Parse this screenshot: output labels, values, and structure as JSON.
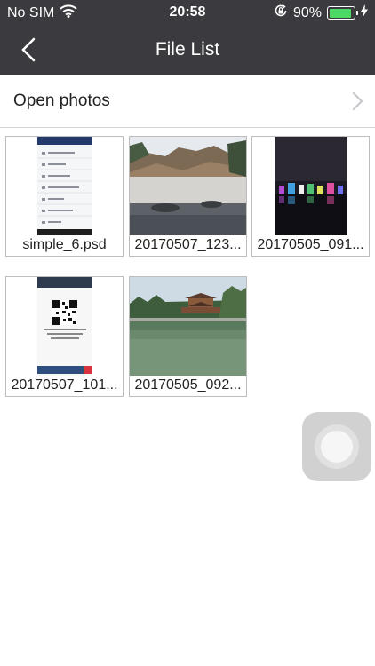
{
  "status_bar": {
    "carrier": "No SIM",
    "time": "20:58",
    "battery": "90%",
    "battery_level": 0.9,
    "icons": [
      "wifi-icon",
      "orientation-lock-icon",
      "battery-icon",
      "charging-bolt-icon"
    ]
  },
  "nav": {
    "title": "File List",
    "back_icon": "chevron-left-icon"
  },
  "open_photos": {
    "label": "Open photos",
    "icon": "chevron-right-icon"
  },
  "files": [
    {
      "name": "simple_6.psd",
      "thumbnail": "app-screenshot"
    },
    {
      "name": "20170507_123...",
      "thumbnail": "waterfall-photo"
    },
    {
      "name": "20170505_091...",
      "thumbnail": "night-fountain-photo"
    },
    {
      "name": "20170507_101...",
      "thumbnail": "qr-code-screenshot"
    },
    {
      "name": "20170505_092...",
      "thumbnail": "pond-pavilion-photo"
    }
  ],
  "colors": {
    "nav_bg": "#3a3a3f",
    "battery_fill": "#4cd964",
    "divider": "#d4d4d4",
    "tile_border": "#bdbdbd"
  }
}
